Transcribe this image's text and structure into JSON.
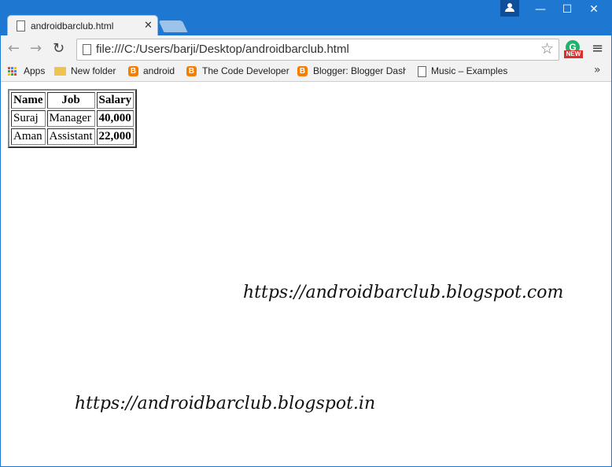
{
  "window": {
    "minimize": "—",
    "maximize": "☐",
    "close": "✕"
  },
  "tab": {
    "title": "androidbarclub.html",
    "close": "✕"
  },
  "toolbar": {
    "back": "←",
    "forward": "→",
    "reload": "↻",
    "url": "file:///C:/Users/barji/Desktop/androidbarclub.html",
    "star": "☆",
    "extension_letter": "G",
    "extension_badge": "NEW",
    "menu": "≡"
  },
  "bookmarks": {
    "items": [
      {
        "label": "Apps",
        "icon": "apps-grid-icon"
      },
      {
        "label": "New folder",
        "icon": "folder-icon"
      },
      {
        "label": "android",
        "icon": "blogger-icon"
      },
      {
        "label": "The Code Developer",
        "icon": "blogger-icon"
      },
      {
        "label": "Blogger: Blogger Dash",
        "icon": "blogger-icon"
      },
      {
        "label": "Music – Examples",
        "icon": "page-icon"
      }
    ],
    "overflow": "»"
  },
  "page": {
    "table": {
      "headers": [
        "Name",
        "Job",
        "Salary"
      ],
      "rows": [
        [
          "Suraj",
          "Manager",
          "40,000"
        ],
        [
          "Aman",
          "Assistant",
          "22,000"
        ]
      ]
    },
    "watermark_com": "https://androidbarclub.blogspot.com",
    "watermark_in": "https://androidbarclub.blogspot.in"
  },
  "colors": {
    "frame": "#1e78d2",
    "toolbar": "#f2f2f2",
    "blogger": "#f57d00"
  }
}
